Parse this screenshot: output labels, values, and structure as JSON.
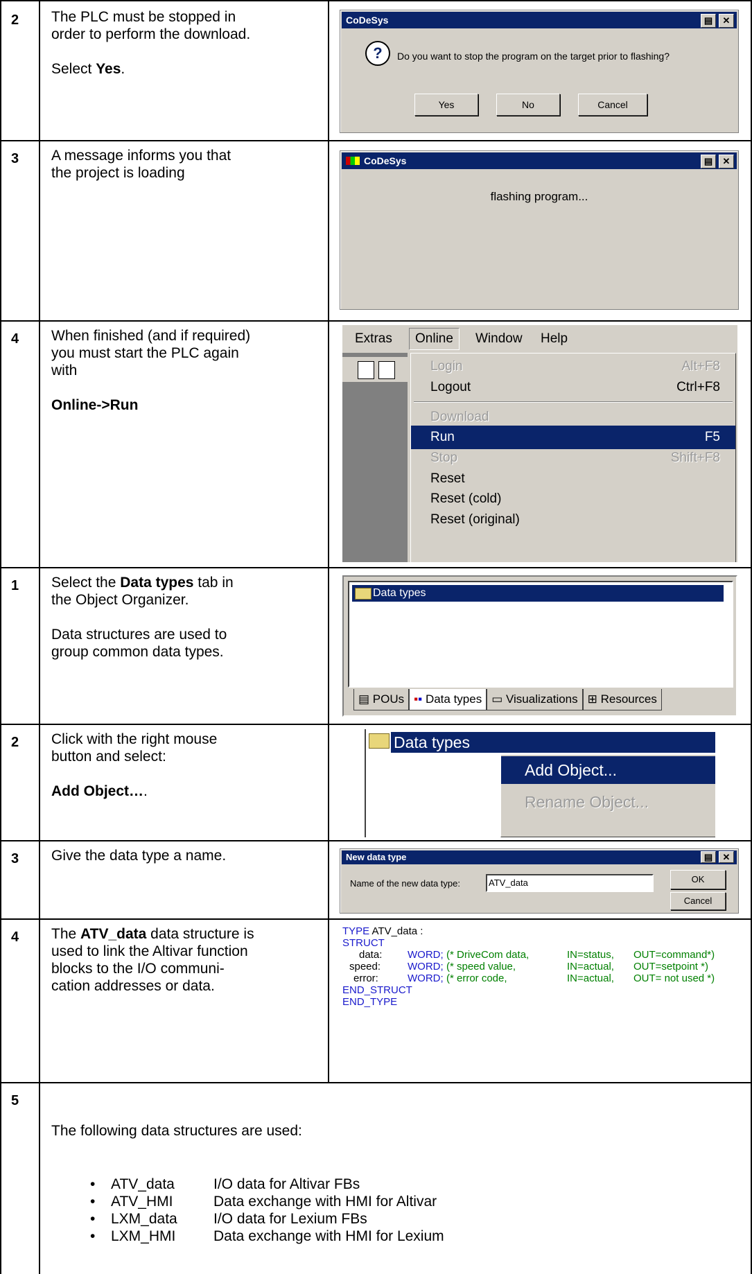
{
  "rows": [
    {
      "num": "2",
      "lines": [
        "The PLC must be stopped in",
        "order to perform the download."
      ],
      "action_prefix": "Select ",
      "action_bold": "Yes",
      "action_suffix": ".",
      "dialog": {
        "title": "CoDeSys",
        "message": "Do you want to stop the program on the target prior to flashing?",
        "buttons": [
          "Yes",
          "No",
          "Cancel"
        ]
      }
    },
    {
      "num": "3",
      "lines": [
        "A message informs you that",
        "the project is loading"
      ],
      "dialog": {
        "title": "CoDeSys",
        "message": "flashing program..."
      }
    },
    {
      "num": "4",
      "lines": [
        "When finished (and if required)",
        "you must start the PLC again",
        "with"
      ],
      "action_bold": "Online->Run",
      "menubar": [
        "Extras",
        "Online",
        "Window",
        "Help"
      ],
      "menu": [
        {
          "label": "Login",
          "shortcut": "Alt+F8",
          "state": "disabled"
        },
        {
          "label": "Logout",
          "shortcut": "Ctrl+F8",
          "state": "normal"
        },
        {
          "label": "Download",
          "shortcut": "",
          "state": "disabled"
        },
        {
          "label": "Run",
          "shortcut": "F5",
          "state": "selected"
        },
        {
          "label": "Stop",
          "shortcut": "Shift+F8",
          "state": "disabled"
        },
        {
          "label": "Reset",
          "shortcut": "",
          "state": "normal"
        },
        {
          "label": "Reset (cold)",
          "shortcut": "",
          "state": "normal"
        },
        {
          "label": "Reset (original)",
          "shortcut": "",
          "state": "normal"
        }
      ]
    },
    {
      "num": "1",
      "line1_prefix": "Select the ",
      "line1_bold": "Data types",
      "line1_suffix": " tab in",
      "line2": "the Object Organizer.",
      "lines_b": [
        "Data structures are used to",
        "group common data types."
      ],
      "tree_item": "Data types",
      "tabs": [
        "POUs",
        "Data types",
        "Visualizations",
        "Resources"
      ]
    },
    {
      "num": "2",
      "lines": [
        "Click with the right mouse",
        "button and select:"
      ],
      "action_bold": "Add Object…",
      "action_suffix": ".",
      "tree_item": "Data types",
      "context_menu": [
        "Add Object...",
        "Rename Object..."
      ]
    },
    {
      "num": "3",
      "lines": [
        "Give the data type a name."
      ],
      "dialog": {
        "title": "New data type",
        "label": "Name of the new data type:",
        "value": "ATV_data",
        "buttons": [
          "OK",
          "Cancel"
        ]
      }
    },
    {
      "num": "4",
      "prefix": "The ",
      "bold": "ATV_data",
      "line1_suffix": " data structure is",
      "lines": [
        "used to link the Altivar function",
        "blocks to the I/O communi-",
        "cation addresses or data."
      ],
      "code": {
        "l1_kw": "TYPE",
        "l1_rest": " ATV_data :",
        "l2": "STRUCT",
        "fields": [
          {
            "name": "data:",
            "type": "WORD;",
            "c1": "(* DriveCom data,",
            "c2": "IN=status,",
            "c3": "OUT=command*)"
          },
          {
            "name": "speed:",
            "type": "WORD;",
            "c1": "(* speed value,",
            "c2": "IN=actual,",
            "c3": "OUT=setpoint *)"
          },
          {
            "name": "error:",
            "type": "WORD;",
            "c1": "(* error code,",
            "c2": "IN=actual,",
            "c3": "OUT= not used *)"
          }
        ],
        "end_struct": "END_STRUCT",
        "end_type": "END_TYPE"
      }
    },
    {
      "num": "5",
      "intro": "The following data structures are used:",
      "items": [
        {
          "name": "ATV_data",
          "desc": "I/O data for Altivar FBs"
        },
        {
          "name": "ATV_HMI",
          "desc": "Data exchange with HMI for Altivar"
        },
        {
          "name": "LXM_data",
          "desc": "I/O data for Lexium FBs"
        },
        {
          "name": "LXM_HMI",
          "desc": "Data exchange with HMI for Lexium"
        }
      ],
      "bullet": "•"
    }
  ]
}
